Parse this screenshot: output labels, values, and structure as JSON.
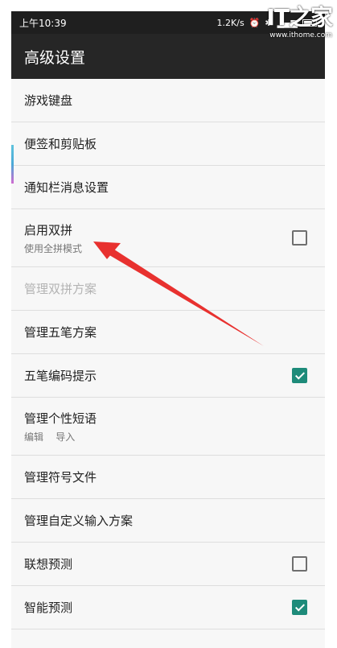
{
  "statusbar": {
    "time": "上午10:39",
    "net_speed": "1.2K/s"
  },
  "watermark": {
    "logo": "IT之家",
    "url": "www.ithome.com"
  },
  "appbar": {
    "title": "高级设置"
  },
  "items": [
    {
      "title": "游戏键盘"
    },
    {
      "title": "便签和剪贴板"
    },
    {
      "title": "通知栏消息设置"
    },
    {
      "title": "启用双拼",
      "summary": "使用全拼模式",
      "checked": false
    },
    {
      "title": "管理双拼方案",
      "disabled": true
    },
    {
      "title": "管理五笔方案"
    },
    {
      "title": "五笔编码提示",
      "checked": true
    },
    {
      "title": "管理个性短语",
      "summary": "编辑    导入"
    },
    {
      "title": "管理符号文件"
    },
    {
      "title": "管理自定义输入方案"
    },
    {
      "title": "联想预测",
      "checked": false
    },
    {
      "title": "智能预测",
      "checked": true
    }
  ],
  "colors": {
    "accent_checked": "#1e8b7a",
    "annotation_arrow": "#e8312f"
  }
}
